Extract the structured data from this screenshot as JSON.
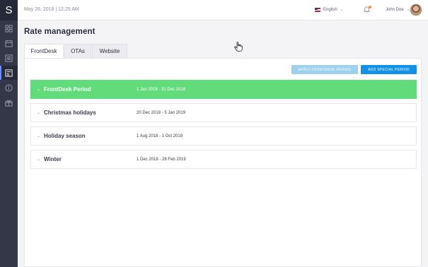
{
  "app": {
    "logo_letter": "S"
  },
  "sidebar": {
    "items": [
      {
        "icon": "grid-icon"
      },
      {
        "icon": "calendar-icon"
      },
      {
        "icon": "list-icon"
      },
      {
        "icon": "rate-icon",
        "active": true
      },
      {
        "icon": "info-icon"
      },
      {
        "icon": "gift-icon"
      }
    ]
  },
  "topbar": {
    "datetime": "May 26, 2018  |  12:25 AM",
    "language": "English",
    "user_name": "John Doe"
  },
  "page": {
    "title": "Rate management"
  },
  "tabs": [
    {
      "label": "FrontDesk"
    },
    {
      "label": "OTAs"
    },
    {
      "label": "Website"
    }
  ],
  "actions": {
    "apply_label": "APPLY FRONTDESK PERIOD",
    "add_label": "ADD SPECIAL PERIOD"
  },
  "periods": [
    {
      "name": "FrontDesk Period",
      "range": "1 Jan 2018 - 31 Dec 2018",
      "highlighted": true
    },
    {
      "name": "Christmas holidays",
      "range": "20 Dec 2018 - 5 Jan 2019"
    },
    {
      "name": "Holiday season",
      "range": "1 Aug 2018 - 1 Oct 2019"
    },
    {
      "name": "Winter",
      "range": "1 Dec 2018 - 28 Feb 2019"
    }
  ],
  "colors": {
    "sidebar": "#333748",
    "highlight_row": "#62dc7b",
    "primary_button": "#1191e8",
    "disabled_button": "#9fd0ee"
  }
}
